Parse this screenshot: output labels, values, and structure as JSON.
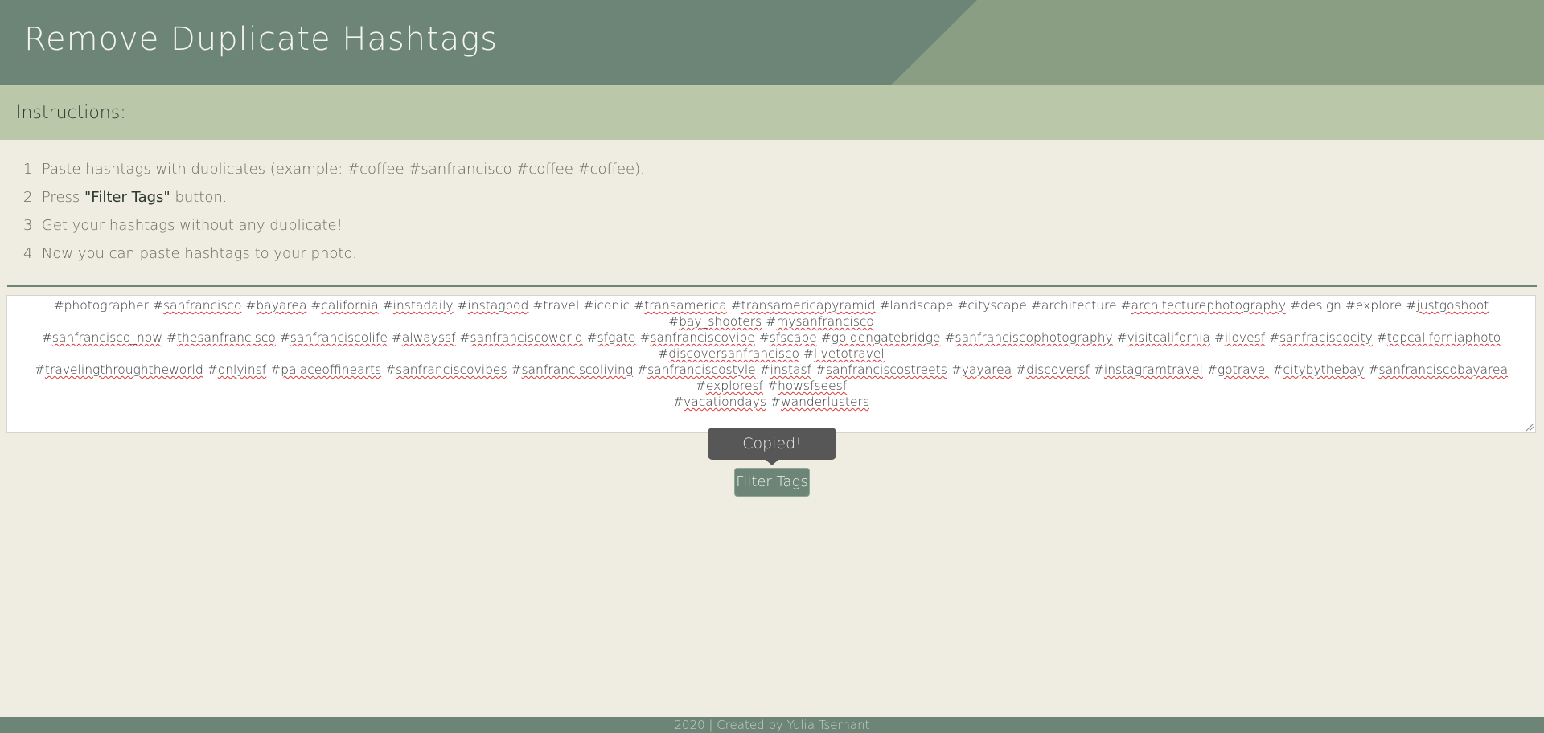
{
  "header": {
    "title": "Remove Duplicate Hashtags"
  },
  "instructions": {
    "heading": "Instructions:",
    "steps": [
      {
        "prefix": "1. Paste hashtags with duplicates (example: #coffee #sanfrancisco #coffee #coffee)."
      },
      {
        "prefix": "2. Press ",
        "bold": "\"Filter Tags\"",
        "suffix": " button."
      },
      {
        "prefix": "3. Get your hashtags without any duplicate!"
      },
      {
        "prefix": "4. Now you can paste hashtags to your photo."
      }
    ]
  },
  "textarea": {
    "lines": [
      "#photographer #sanfrancisco #bayarea #california #instadaily #instagood #travel #iconic #transamerica #transamericapyramid #landscape #cityscape #architecture #architecturephotography #design #explore #justgoshoot #bay_shooters #mysanfrancisco",
      "#sanfrancisco_now #thesanfrancisco #sanfranciscolife #alwayssf #sanfranciscoworld #sfgate #sanfranciscovibe #sfscape #goldengatebridge #sanfranciscophotography #visitcalifornia #ilovesf #sanfraciscocity #topcaliforniaphoto #discoversanfrancisco #livetotravel",
      "#travelingthroughtheworld #onlyinsf #palaceoffinearts #sanfranciscovibes #sanfranciscoliving #sanfranciscostyle #instasf #sanfranciscostreets #yayarea #discoversf #instagramtravel #gotravel #citybythebay #sanfranciscobayarea #exploresf #howsfseesf",
      "#vacationdays #wanderlusters"
    ]
  },
  "tooltip": {
    "text": "Copied!"
  },
  "filter_button": {
    "label": "Filter Tags"
  },
  "footer": {
    "text": "2020 | Created by Yulia Tsernant"
  },
  "colors": {
    "header_dark": "#6c8577",
    "header_light": "#899e82",
    "instructions_bar": "#bac7a9",
    "page_background": "#efece1",
    "tooltip_background": "#575757"
  }
}
